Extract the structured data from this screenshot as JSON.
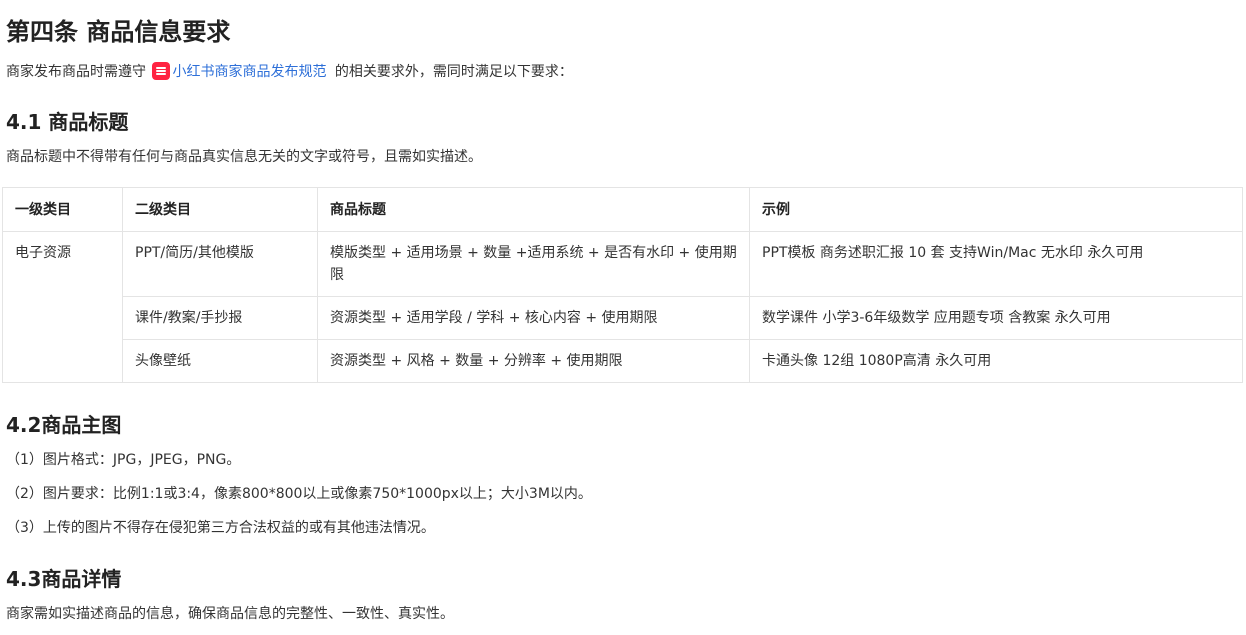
{
  "article": {
    "title": "第四条 商品信息要求",
    "intro": {
      "before": "商家发布商品时需遵守",
      "link_icon": "xiaohongshu-logo-icon",
      "link_text": "小红书商家商品发布规范",
      "after": "的相关要求外，需同时满足以下要求："
    }
  },
  "sections": {
    "s41": {
      "heading": "4.1 商品标题",
      "desc": "商品标题中不得带有任何与商品真实信息无关的文字或符号，且需如实描述。"
    },
    "s42": {
      "heading": "4.2商品主图",
      "items": [
        "（1）图片格式：JPG，JPEG，PNG。",
        "（2）图片要求：比例1:1或3:4，像素800*800以上或像素750*1000px以上；大小3M以内。",
        "（3）上传的图片不得存在侵犯第三方合法权益的或有其他违法情况。"
      ]
    },
    "s43": {
      "heading": "4.3商品详情",
      "desc": "商家需如实描述商品的信息，确保商品信息的完整性、一致性、真实性。"
    }
  },
  "table": {
    "headers": [
      "一级类目",
      "二级类目",
      "商品标题",
      "示例"
    ],
    "rows": [
      {
        "level1": "电子资源",
        "level2": "PPT/简历/其他模版",
        "title_rule": "模版类型 + 适用场景 + 数量 +适用系统 + 是否有水印 + 使用期限",
        "example": "PPT模板 商务述职汇报 10 套 支持Win/Mac 无水印 永久可用"
      },
      {
        "level2": "课件/教案/手抄报",
        "title_rule": "资源类型 + 适用学段 / 学科 + 核心内容 + 使用期限",
        "example": "数学课件 小学3-6年级数学 应用题专项 含教案 永久可用"
      },
      {
        "level2": "头像壁纸",
        "title_rule": "资源类型 + 风格 + 数量 + 分辨率 + 使用期限",
        "example": "卡通头像 12组 1080P高清 永久可用"
      }
    ]
  },
  "colors": {
    "link": "#2d6fd8",
    "brand_badge": "#ff2442",
    "border": "#e4e4e4"
  }
}
